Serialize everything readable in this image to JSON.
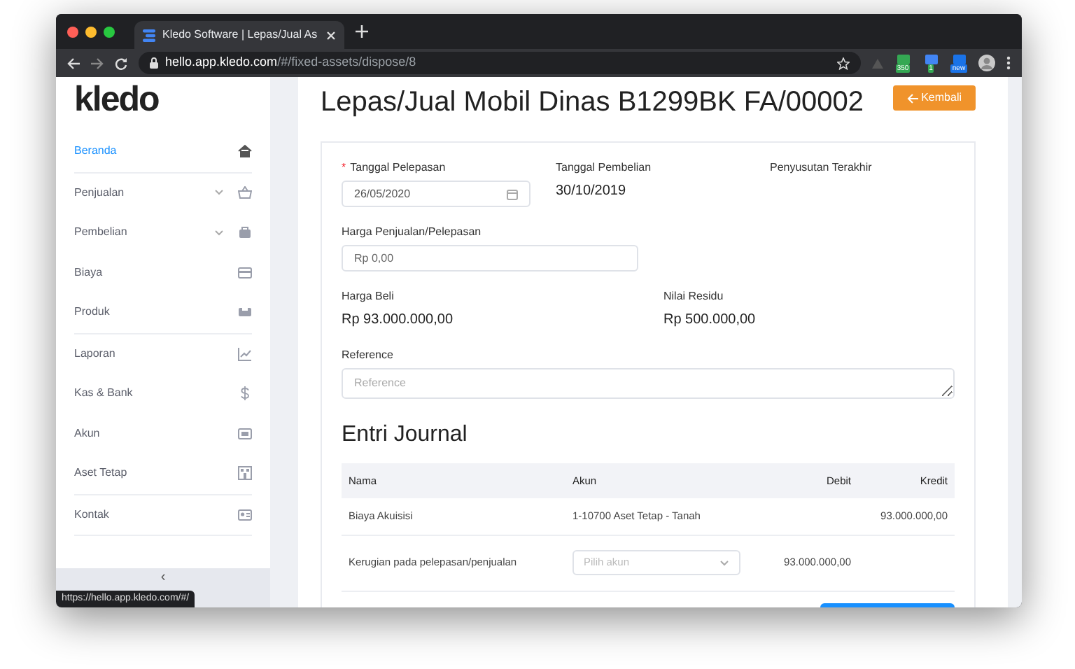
{
  "browser": {
    "tab_title": "Kledo Software | Lepas/Jual As",
    "url_host": "hello.app.kledo.com",
    "url_path": "/#/fixed-assets/dispose/8",
    "extensions": [
      {
        "badge": "350"
      },
      {
        "badge": "1"
      },
      {
        "badge": "new"
      }
    ],
    "status_url": "https://hello.app.kledo.com/#/"
  },
  "sidebar": {
    "logo": "kledo",
    "groups": [
      [
        {
          "label": "Beranda",
          "selected": true,
          "expandable": false
        }
      ],
      [
        {
          "label": "Penjualan",
          "selected": false,
          "expandable": true
        },
        {
          "label": "Pembelian",
          "selected": false,
          "expandable": true
        },
        {
          "label": "Biaya",
          "selected": false,
          "expandable": false
        },
        {
          "label": "Produk",
          "selected": false,
          "expandable": false
        }
      ],
      [
        {
          "label": "Laporan",
          "selected": false,
          "expandable": false
        },
        {
          "label": "Kas & Bank",
          "selected": false,
          "expandable": false
        },
        {
          "label": "Akun",
          "selected": false,
          "expandable": false
        },
        {
          "label": "Aset Tetap",
          "selected": false,
          "expandable": false
        }
      ],
      [
        {
          "label": "Kontak",
          "selected": false,
          "expandable": false
        }
      ]
    ],
    "collapse": "‹"
  },
  "page": {
    "title": "Lepas/Jual Mobil Dinas B1299BK FA/00002",
    "back_button": "Kembali",
    "form": {
      "disposal_date": {
        "label": "Tanggal Pelepasan",
        "required_mark": "*",
        "value": "26/05/2020"
      },
      "purchase_date": {
        "label": "Tanggal Pembelian",
        "value": "30/10/2019"
      },
      "last_depreciation": {
        "label": "Penyusutan Terakhir"
      },
      "sale_price": {
        "label": "Harga Penjualan/Pelepasan",
        "placeholder": "Rp 0,00"
      },
      "purchase_price": {
        "label": "Harga Beli",
        "value": "Rp 93.000.000,00"
      },
      "residual_value": {
        "label": "Nilai Residu",
        "value": "Rp 500.000,00"
      },
      "reference": {
        "label": "Reference",
        "placeholder": "Reference"
      }
    },
    "journal": {
      "title": "Entri Journal",
      "columns": [
        "Nama",
        "Akun",
        "Debit",
        "Kredit"
      ],
      "rows": [
        {
          "nama": "Biaya Akuisisi",
          "akun": {
            "kind": "text",
            "text": "1-10700 Aset Tetap - Tanah"
          },
          "kredit": "93.000.000,00"
        },
        {
          "nama": "Kerugian pada pelepasan/penjualan",
          "akun": {
            "kind": "select",
            "placeholder": "Pilih akun"
          },
          "debit": "93.000.000,00"
        }
      ]
    }
  }
}
